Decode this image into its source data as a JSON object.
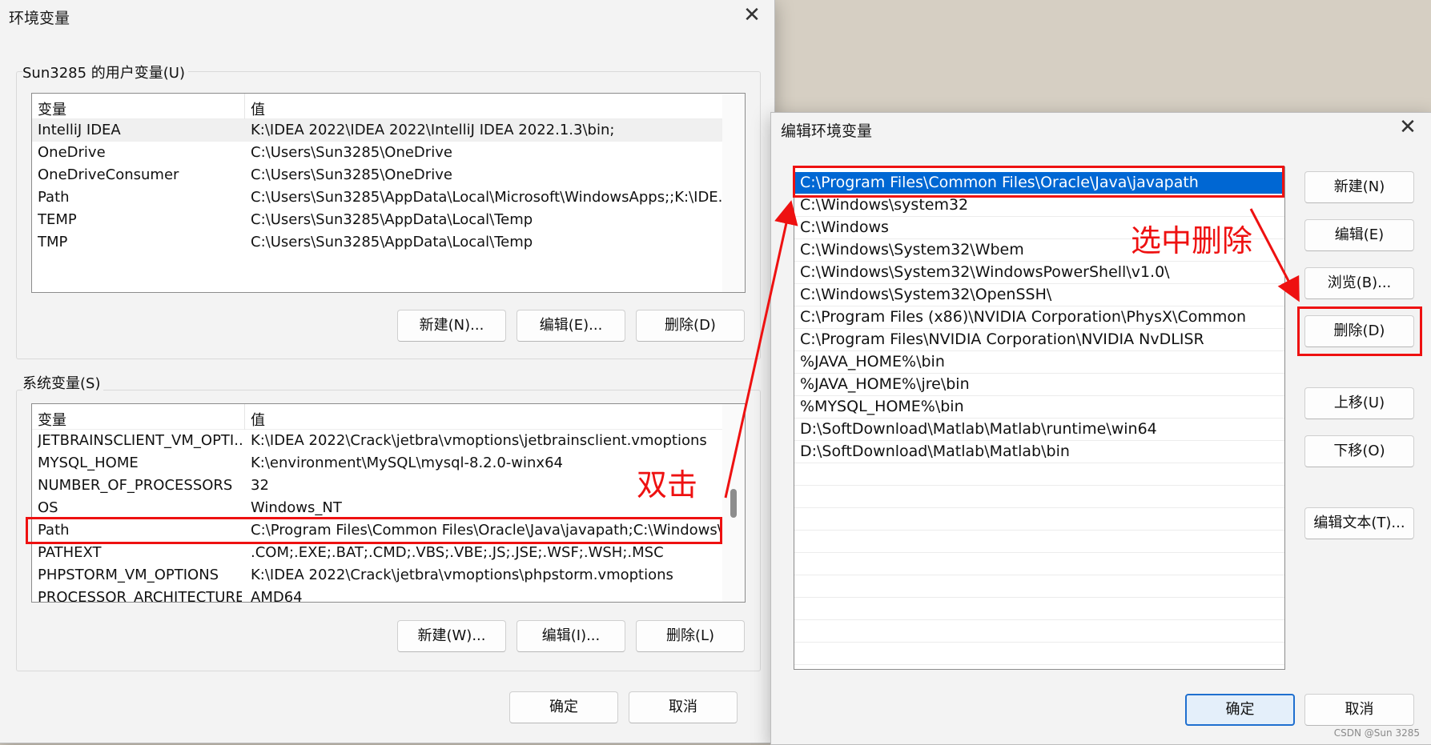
{
  "env_dialog": {
    "title": "环境变量",
    "close_glyph": "✕",
    "user_group_label": "Sun3285 的用户变量(U)",
    "system_group_label": "系统变量(S)",
    "col_var": "变量",
    "col_val": "值",
    "user_vars": [
      {
        "name": "IntelliJ IDEA",
        "value": "K:\\IDEA 2022\\IDEA 2022\\IntelliJ IDEA 2022.1.3\\bin;"
      },
      {
        "name": "OneDrive",
        "value": "C:\\Users\\Sun3285\\OneDrive"
      },
      {
        "name": "OneDriveConsumer",
        "value": "C:\\Users\\Sun3285\\OneDrive"
      },
      {
        "name": "Path",
        "value": "C:\\Users\\Sun3285\\AppData\\Local\\Microsoft\\WindowsApps;;K:\\IDE..."
      },
      {
        "name": "TEMP",
        "value": "C:\\Users\\Sun3285\\AppData\\Local\\Temp"
      },
      {
        "name": "TMP",
        "value": "C:\\Users\\Sun3285\\AppData\\Local\\Temp"
      }
    ],
    "system_vars": [
      {
        "name": "JETBRAINSCLIENT_VM_OPTI...",
        "value": "K:\\IDEA 2022\\Crack\\jetbra\\vmoptions\\jetbrainsclient.vmoptions"
      },
      {
        "name": "MYSQL_HOME",
        "value": "K:\\environment\\MySQL\\mysql-8.2.0-winx64"
      },
      {
        "name": "NUMBER_OF_PROCESSORS",
        "value": "32"
      },
      {
        "name": "OS",
        "value": "Windows_NT"
      },
      {
        "name": "Path",
        "value": "C:\\Program Files\\Common Files\\Oracle\\Java\\javapath;C:\\Windows\\..."
      },
      {
        "name": "PATHEXT",
        "value": ".COM;.EXE;.BAT;.CMD;.VBS;.VBE;.JS;.JSE;.WSF;.WSH;.MSC"
      },
      {
        "name": "PHPSTORM_VM_OPTIONS",
        "value": "K:\\IDEA 2022\\Crack\\jetbra\\vmoptions\\phpstorm.vmoptions"
      },
      {
        "name": "PROCESSOR_ARCHITECTURE",
        "value": "AMD64"
      }
    ],
    "user_buttons": {
      "new": "新建(N)...",
      "edit": "编辑(E)...",
      "delete": "删除(D)"
    },
    "system_buttons": {
      "new": "新建(W)...",
      "edit": "编辑(I)...",
      "delete": "删除(L)"
    },
    "ok": "确定",
    "cancel": "取消"
  },
  "edit_dialog": {
    "title": "编辑环境变量",
    "close_glyph": "✕",
    "entries": [
      "C:\\Program Files\\Common Files\\Oracle\\Java\\javapath",
      "C:\\Windows\\system32",
      "C:\\Windows",
      "C:\\Windows\\System32\\Wbem",
      "C:\\Windows\\System32\\WindowsPowerShell\\v1.0\\",
      "C:\\Windows\\System32\\OpenSSH\\",
      "C:\\Program Files (x86)\\NVIDIA Corporation\\PhysX\\Common",
      "C:\\Program Files\\NVIDIA Corporation\\NVIDIA NvDLISR",
      "%JAVA_HOME%\\bin",
      "%JAVA_HOME%\\jre\\bin",
      "%MYSQL_HOME%\\bin",
      "D:\\SoftDownload\\Matlab\\Matlab\\runtime\\win64",
      "D:\\SoftDownload\\Matlab\\Matlab\\bin"
    ],
    "selected_index": 0,
    "buttons": {
      "new": "新建(N)",
      "edit": "编辑(E)",
      "browse": "浏览(B)...",
      "delete": "删除(D)",
      "move_up": "上移(U)",
      "move_down": "下移(O)",
      "edit_text": "编辑文本(T)..."
    },
    "ok": "确定",
    "cancel": "取消"
  },
  "annotations": {
    "double_click": "双击",
    "select_delete": "选中删除",
    "color": "#ee1111"
  },
  "watermark": "CSDN @Sun 3285"
}
